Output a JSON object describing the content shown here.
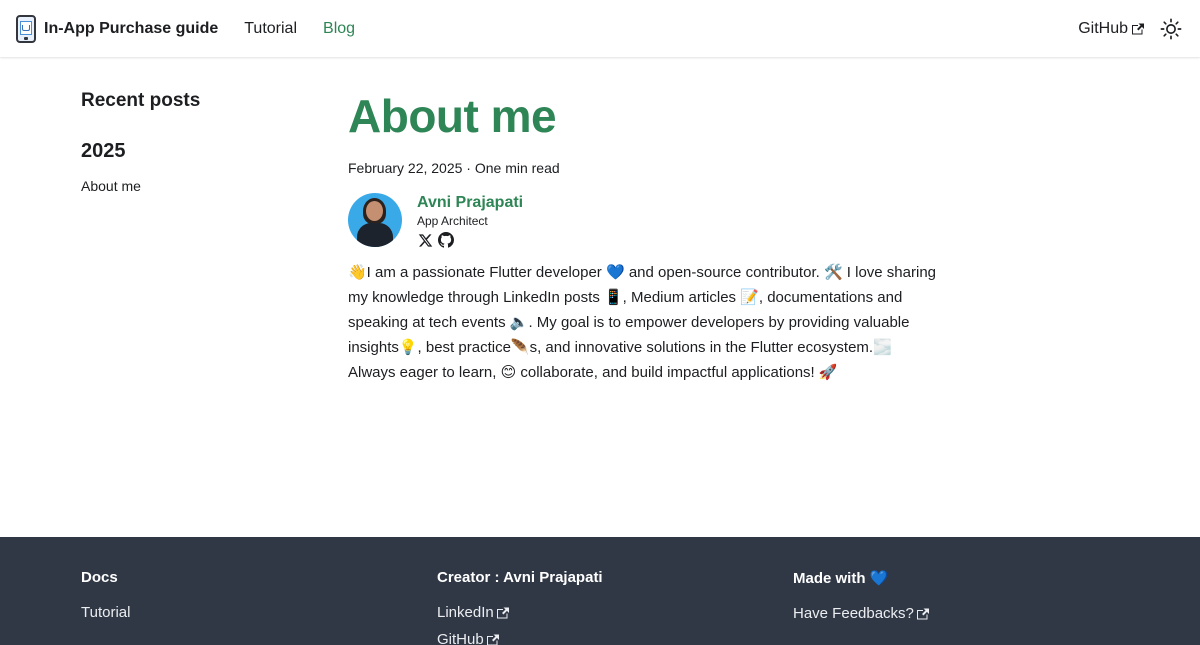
{
  "navbar": {
    "brand_title": "In-App Purchase guide",
    "links": [
      {
        "label": "Tutorial"
      },
      {
        "label": "Blog"
      }
    ],
    "github_label": "GitHub",
    "accent": "#2e8555"
  },
  "sidebar": {
    "title": "Recent posts",
    "year": "2025",
    "items": [
      {
        "label": "About me"
      }
    ]
  },
  "post": {
    "title": "About me",
    "meta": "February 22, 2025 · One min read",
    "author": {
      "name": "Avni Prajapati",
      "role": "App Architect",
      "socials": [
        "x-icon",
        "github-icon"
      ]
    },
    "body": "👋I am a passionate Flutter developer 💙 and open-source contributor. 🛠️ I love sharing my knowledge through LinkedIn posts 📱, Medium articles 📝, documentations and speaking at tech events 🔈. My goal is to empower developers by providing valuable insights💡, best practice🪶s, and innovative solutions in the Flutter ecosystem.🌫️ Always eager to learn, 😊 collaborate, and build impactful applications! 🚀"
  },
  "footer": {
    "background": "#303846",
    "columns": [
      {
        "title": "Docs",
        "links": [
          {
            "label": "Tutorial"
          }
        ]
      },
      {
        "title": "Creator : Avni Prajapati",
        "links": [
          {
            "label": "LinkedIn"
          },
          {
            "label": "GitHub"
          }
        ]
      },
      {
        "title": "Made with 💙",
        "links": [
          {
            "label": "Have Feedbacks?"
          }
        ]
      }
    ]
  }
}
